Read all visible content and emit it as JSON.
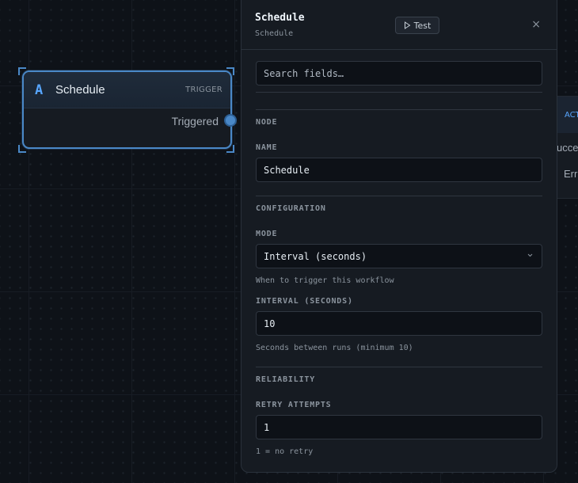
{
  "canvas": {
    "trigger_node": {
      "icon_text": "A",
      "title": "Schedule",
      "type": "TRIGGER",
      "output": "Triggered"
    },
    "action_node": {
      "type": "ACT",
      "row1": "ucce",
      "row2": "Err"
    }
  },
  "panel": {
    "title": "Schedule",
    "subtitle": "Schedule",
    "test_label": "Test",
    "close_icon": "×",
    "search_placeholder": "Search fields…",
    "sections": {
      "node": {
        "title": "NODE",
        "name_label": "NAME",
        "name_value": "Schedule"
      },
      "configuration": {
        "title": "CONFIGURATION",
        "mode_label": "MODE",
        "mode_value": "Interval (seconds)",
        "mode_hint": "When to trigger this workflow",
        "interval_label": "INTERVAL (SECONDS)",
        "interval_value": "10",
        "interval_hint": "Seconds between runs (minimum 10)"
      },
      "reliability": {
        "title": "RELIABILITY",
        "retry_label": "RETRY ATTEMPTS",
        "retry_value": "1",
        "retry_hint": "1 = no retry"
      }
    }
  },
  "colors": {
    "accent": "#4a88c7",
    "panel_bg": "#161b22",
    "canvas_bg": "#0e1218"
  }
}
